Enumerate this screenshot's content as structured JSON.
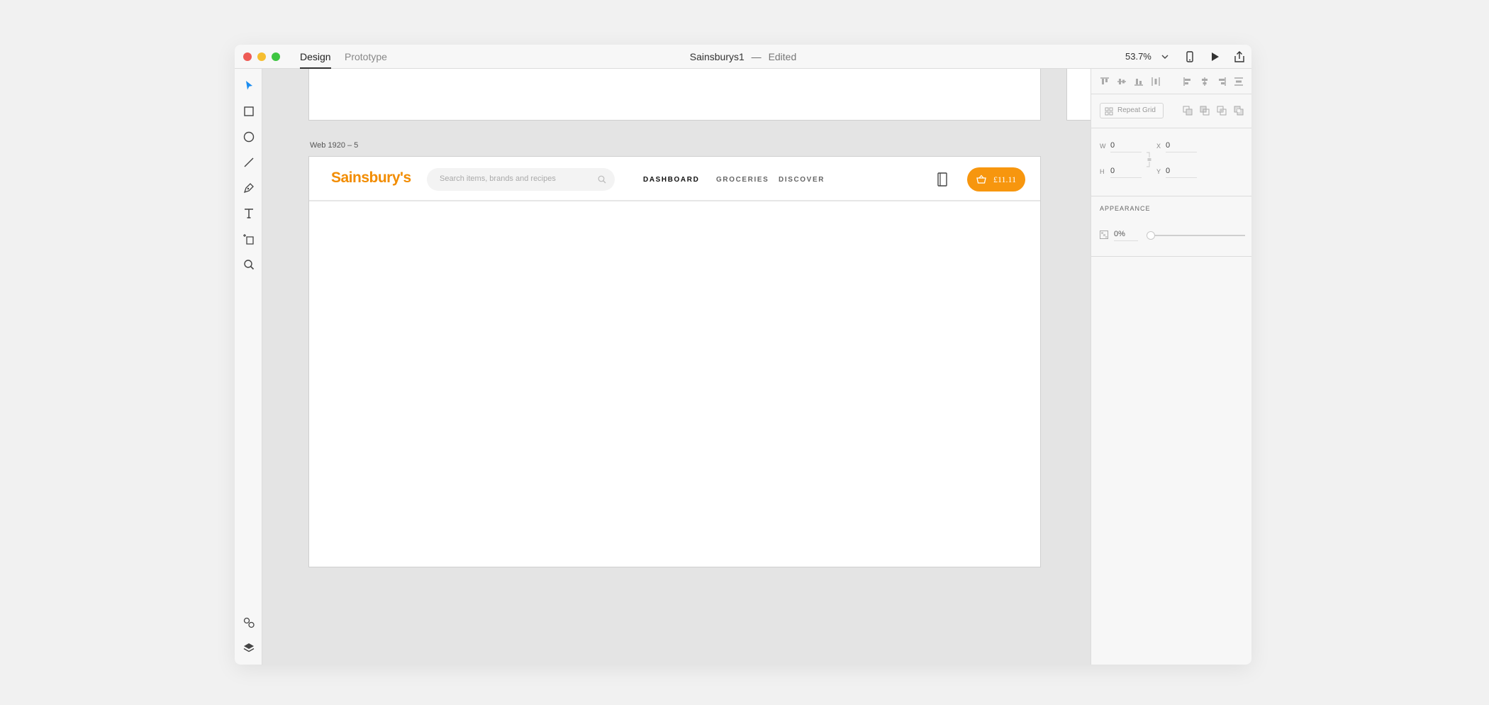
{
  "window": {
    "tabs": [
      {
        "label": "Design",
        "active": true
      },
      {
        "label": "Prototype",
        "active": false
      }
    ],
    "document_title": "Sainsburys1",
    "separator": "—",
    "status": "Edited",
    "zoom": "53.7%"
  },
  "toolbar": {
    "tools": [
      "select-tool-icon",
      "rectangle-tool-icon",
      "ellipse-tool-icon",
      "line-tool-icon",
      "pen-tool-icon",
      "text-tool-icon",
      "artboard-tool-icon",
      "zoom-tool-icon"
    ],
    "bottom": [
      "symbols-icon",
      "layers-icon"
    ],
    "accent": "#1a8cf0"
  },
  "canvas": {
    "artboard_label": "Web 1920 – 5",
    "site": {
      "logo": "Sainsbury's",
      "brand_color": "#f28c00",
      "search_placeholder": "Search items, brands and recipes",
      "nav": [
        {
          "label": "DASHBOARD",
          "active": true
        },
        {
          "label": "GROCERIES",
          "active": false
        },
        {
          "label": "DISCOVER",
          "active": false
        }
      ],
      "basket_value": "£11.11",
      "basket_color": "#f7960e"
    }
  },
  "inspector": {
    "repeat_grid_label": "Repeat Grid",
    "w_label": "W",
    "w_value": "0",
    "h_label": "H",
    "h_value": "0",
    "x_label": "X",
    "x_value": "0",
    "y_label": "Y",
    "y_value": "0",
    "appearance_title": "APPEARANCE",
    "opacity_value": "0%",
    "opacity_fraction": 0
  }
}
